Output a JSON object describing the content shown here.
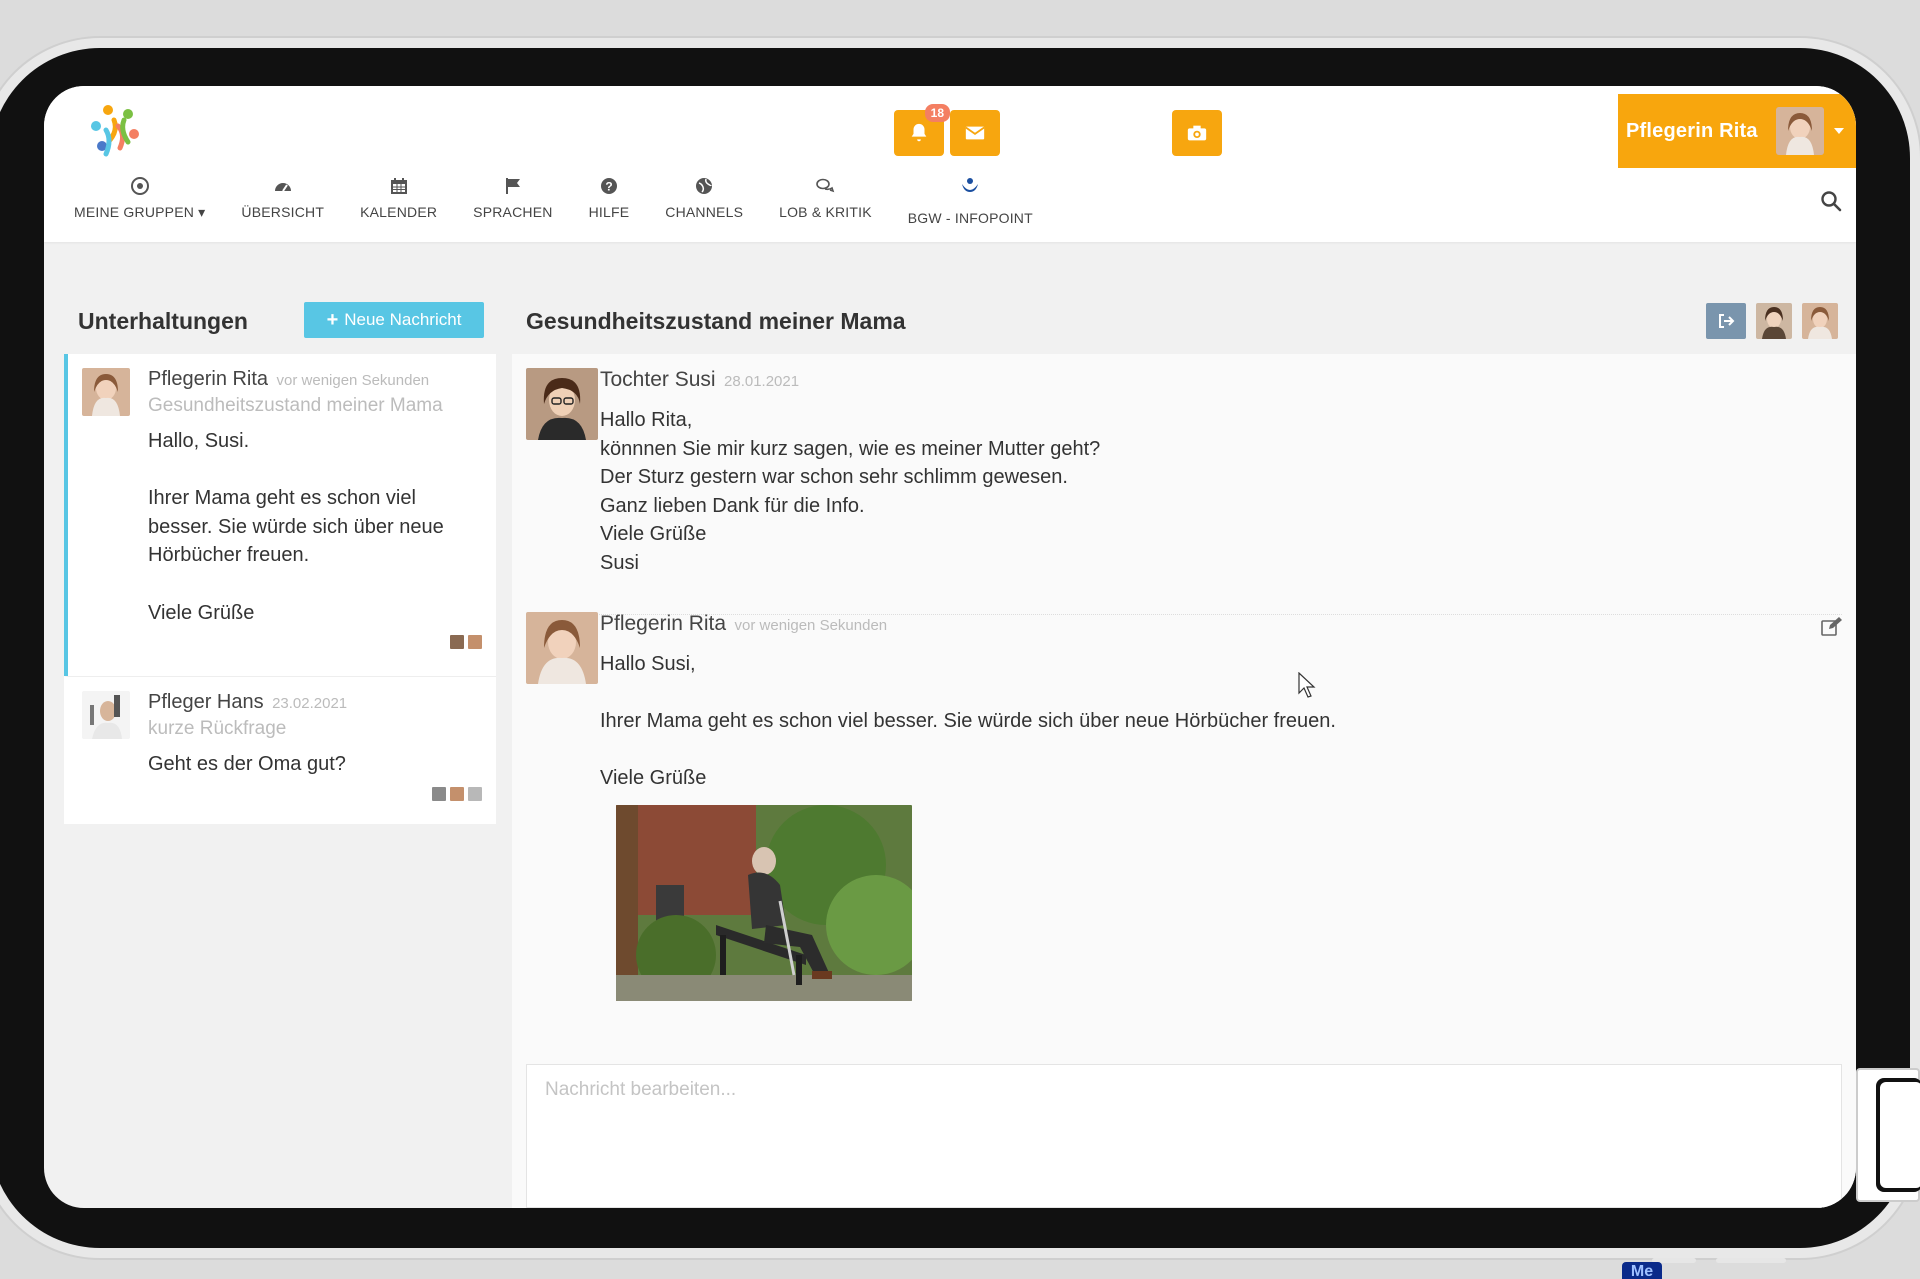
{
  "header": {
    "notification_count": "18",
    "user_name": "Pflegerin Rita",
    "nav": [
      {
        "label": "MEINE GRUPPEN",
        "icon": "target-icon",
        "dropdown": true
      },
      {
        "label": "ÜBERSICHT",
        "icon": "dashboard-icon"
      },
      {
        "label": "KALENDER",
        "icon": "calendar-icon"
      },
      {
        "label": "SPRACHEN",
        "icon": "flag-icon"
      },
      {
        "label": "HILFE",
        "icon": "question-icon"
      },
      {
        "label": "CHANNELS",
        "icon": "globe-icon"
      },
      {
        "label": "LOB & KRITIK",
        "icon": "chat-bubbles-icon"
      },
      {
        "label": "BGW - INFOPOINT",
        "icon": "bgw-logo-icon"
      }
    ]
  },
  "colors": {
    "accent_orange": "#f7a60f",
    "accent_blue": "#58c6e4",
    "badge_red": "#f47f62",
    "leave_btn": "#7a95ad"
  },
  "conversations": {
    "title": "Unterhaltungen",
    "new_button": "Neue Nachricht",
    "items": [
      {
        "name": "Pflegerin Rita",
        "time": "vor wenigen Sekunden",
        "subject": "Gesundheitszustand meiner Mama",
        "preview": "Hallo, Susi.\n\nIhrer Mama geht es schon viel besser. Sie würde sich über neue Hörbücher freuen.\n\nViele Grüße",
        "active": true
      },
      {
        "name": "Pfleger Hans",
        "time": "23.02.2021",
        "subject": "kurze Rückfrage",
        "preview": "Geht es der Oma gut?",
        "active": false
      }
    ]
  },
  "chat": {
    "title": "Gesundheitszustand meiner Mama",
    "messages": [
      {
        "author": "Tochter Susi",
        "time": "28.01.2021",
        "body": "Hallo Rita,\nkönnnen Sie mir kurz sagen, wie es meiner Mutter geht?\nDer Sturz gestern war schon sehr schlimm gewesen.\nGanz lieben Dank für die Info.\nViele Grüße\nSusi"
      },
      {
        "author": "Pflegerin Rita",
        "time": "vor wenigen Sekunden",
        "body": "Hallo Susi,\n\nIhrer Mama geht es schon viel besser. Sie würde sich über neue Hörbücher freuen.\n\nViele Grüße"
      }
    ],
    "compose_placeholder": "Nachricht bearbeiten..."
  },
  "taskbar": {
    "app_label": "Me"
  }
}
